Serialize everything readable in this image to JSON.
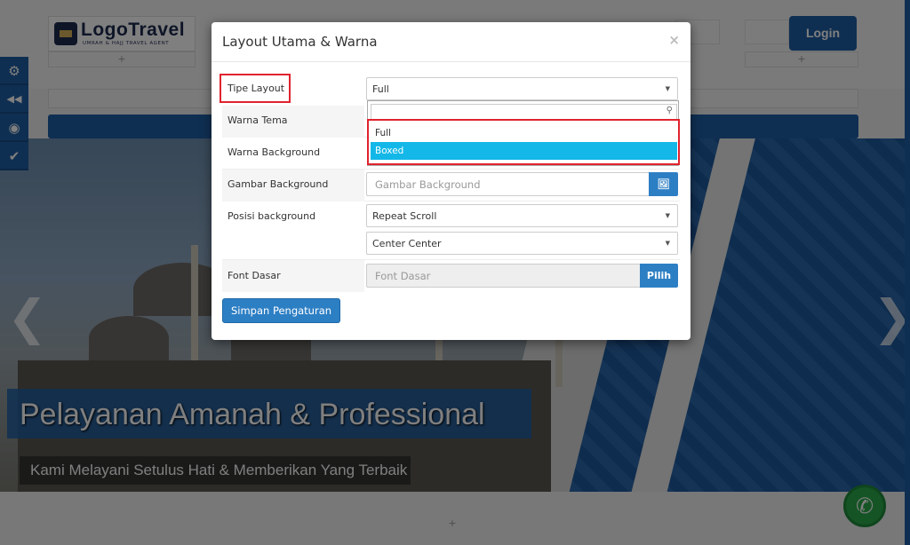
{
  "site": {
    "logo_text": "LogoTravel",
    "logo_tagline": "UMRAH & HAJJ TRAVEL AGENT",
    "plus_symbol": "+",
    "login_label": "Login",
    "hero_title": "Pelayanan Amanah & Professional",
    "hero_subtitle": "Kami Melayani Setulus Hati & Memberikan Yang Terbaik",
    "arrow_left": "❮",
    "arrow_right": "❯",
    "tools": [
      {
        "icon": "gears-icon",
        "glyph": "⚙"
      },
      {
        "icon": "collapse-icon",
        "glyph": "◀◀"
      },
      {
        "icon": "eye-icon",
        "glyph": "◉"
      },
      {
        "icon": "check-icon",
        "glyph": "✔"
      }
    ],
    "whatsapp_glyph": "✆",
    "accent_color": "#1e5fa5"
  },
  "modal": {
    "title": "Layout Utama & Warna",
    "close_symbol": "×",
    "tipe_layout_label": "Tipe Layout",
    "tipe_layout_value": "Full",
    "warna_tema_label": "Warna Tema",
    "warna_background_label": "Warna Background",
    "gambar_background_label": "Gambar Background",
    "gambar_background_placeholder": "Gambar Background",
    "gambar_icon": "🖼",
    "posisi_background_label": "Posisi background",
    "posisi_value_1": "Repeat Scroll",
    "posisi_value_2": "Center Center",
    "font_dasar_label": "Font Dasar",
    "font_dasar_placeholder": "Font Dasar",
    "pilih_label": "Pilih",
    "save_label": "Simpan Pengaturan",
    "dropdown": {
      "search_icon": "⚲",
      "options": [
        "Full",
        "Boxed"
      ],
      "active_option": "Boxed"
    },
    "caret": "▼",
    "highlight_color": "#e0232f",
    "active_option_color": "#14b8e8"
  }
}
